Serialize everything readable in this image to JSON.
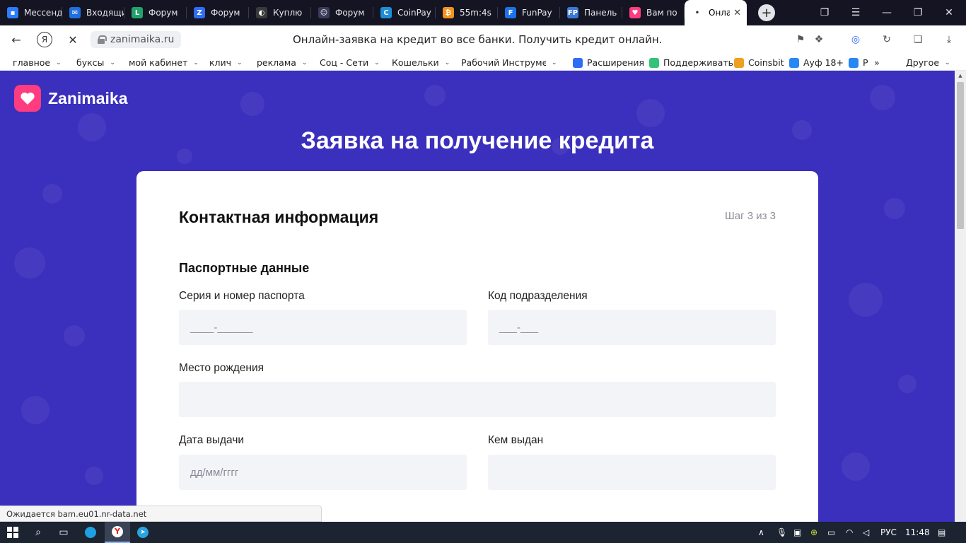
{
  "browser": {
    "tabs": [
      {
        "title": "Мессенджер",
        "color": "#2b7cff",
        "glyph": "▪"
      },
      {
        "title": "Входящие",
        "color": "#1f6fe0",
        "glyph": "✉"
      },
      {
        "title": "Форум",
        "color": "#22a36b",
        "glyph": "L"
      },
      {
        "title": "Форум",
        "color": "#2f6df6",
        "glyph": "Z"
      },
      {
        "title": "Куплю",
        "color": "#3a3a3a",
        "glyph": "◐"
      },
      {
        "title": "Форум",
        "color": "#3a3a5a",
        "glyph": "☺"
      },
      {
        "title": "CoinPay",
        "color": "#1c8fd6",
        "glyph": "C"
      },
      {
        "title": "55m:4s",
        "color": "#f7931a",
        "glyph": "₿"
      },
      {
        "title": "FunPay",
        "color": "#1a73e8",
        "glyph": "F"
      },
      {
        "title": "Панель",
        "color": "#3b78d8",
        "glyph": "FP"
      },
      {
        "title": "Вам по",
        "color": "#ff3c7f",
        "glyph": "♥"
      }
    ],
    "active_tab": {
      "title": "Онлайн-заявка"
    },
    "new_tab_label": "+",
    "url": "zanimaika.ru",
    "page_title": "Онлайн-заявка на кредит во все банки. Получить кредит онлайн.",
    "bookmarks": [
      {
        "label": "главное",
        "folder": true
      },
      {
        "label": "буксы",
        "folder": true
      },
      {
        "label": "мой кабинет",
        "folder": true
      },
      {
        "label": "клич",
        "folder": true
      },
      {
        "label": "реклама",
        "folder": true
      },
      {
        "label": "Соц - Сети",
        "folder": true
      },
      {
        "label": "Кошельки",
        "folder": true
      },
      {
        "label": "Рабочий Инструмен",
        "folder": true
      },
      {
        "label": "Расширения",
        "folder": false,
        "color": "#2f6df6"
      },
      {
        "label": "Поддерживать",
        "folder": false,
        "color": "#33c27a"
      },
      {
        "label": "Coinsbit",
        "folder": false,
        "color": "#f0a020"
      },
      {
        "label": "Ауф 18+",
        "folder": false,
        "color": "#2787f5"
      },
      {
        "label": "Р",
        "folder": false,
        "color": "#2787f5"
      },
      {
        "label": "Другое",
        "folder": true
      }
    ],
    "status_text": "Ожидается bam.eu01.nr-data.net"
  },
  "site": {
    "brand": "Zanimaika",
    "brand_color": "#ff3c7f",
    "headline": "Заявка на получение кредита",
    "form": {
      "section_title": "Контактная информация",
      "step": "Шаг 3 из 3",
      "subsection": "Паспортные данные",
      "passport_label": "Серия и номер паспорта",
      "passport_placeholder": "____-______",
      "division_label": "Код подразделения",
      "division_placeholder": "___-___",
      "birthplace_label": "Место рождения",
      "birthplace_placeholder": "",
      "issue_date_label": "Дата выдачи",
      "issue_date_placeholder": "дд/мм/гггг",
      "issued_by_label": "Кем выдан",
      "issued_by_placeholder": ""
    }
  },
  "taskbar": {
    "language": "РУС",
    "time": "11:48"
  }
}
